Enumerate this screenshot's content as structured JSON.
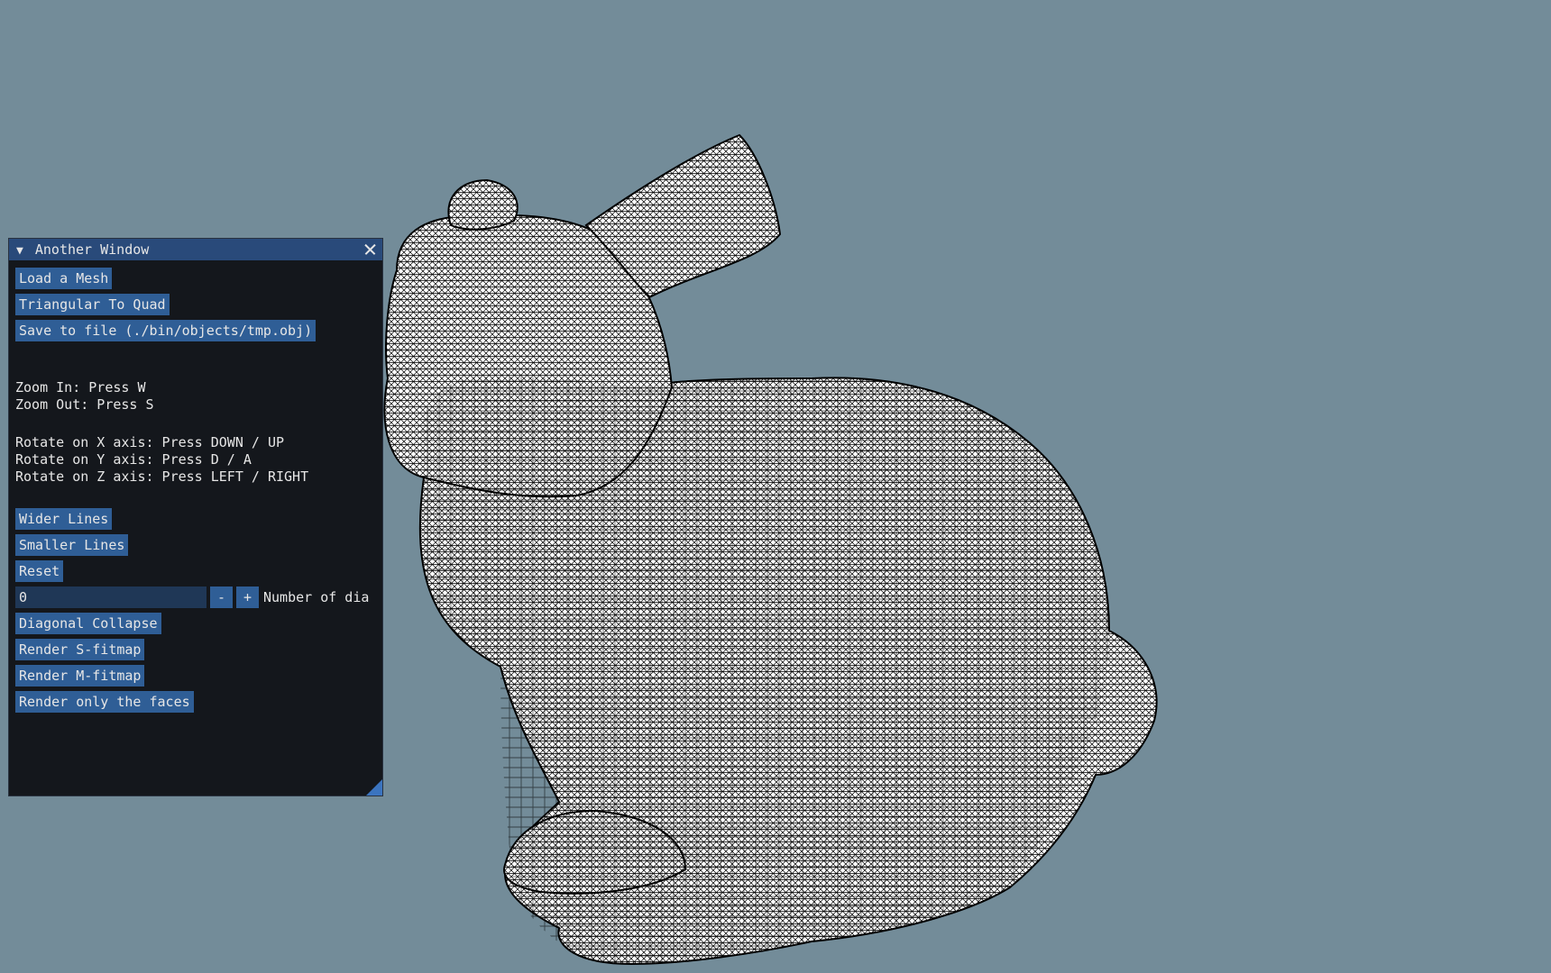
{
  "colors": {
    "background": "#738c99",
    "window_bg": "#14171c",
    "title_bar": "#294a7a",
    "button": "#2f5e96",
    "input_bg": "#1f3756",
    "text": "#e6e6e6",
    "mesh_fill": "#ffffff",
    "mesh_lines": "#000000"
  },
  "window": {
    "title": "Another Window",
    "collapse_icon": "triangle-down-icon",
    "close_icon": "close-icon",
    "buttons_top": {
      "load": "Load a Mesh",
      "tri_to_quad": "Triangular To Quad",
      "save": "Save to file (./bin/objects/tmp.obj)"
    },
    "help": {
      "zoom_in": "Zoom In: Press W",
      "zoom_out": "Zoom Out: Press S",
      "rot_x": "Rotate on X axis: Press DOWN / UP",
      "rot_y": "Rotate on Y axis: Press D / A",
      "rot_z": "Rotate on Z axis: Press LEFT / RIGHT"
    },
    "buttons_mid": {
      "wider": "Wider Lines",
      "smaller": "Smaller Lines",
      "reset": "Reset"
    },
    "diagonal_input": {
      "value": "0",
      "minus": "-",
      "plus": "+",
      "label": "Number of dia"
    },
    "buttons_bottom": {
      "diag_collapse": "Diagonal Collapse",
      "s_fitmap": "Render S-fitmap",
      "m_fitmap": "Render M-fitmap",
      "faces": "Render only the faces"
    }
  }
}
